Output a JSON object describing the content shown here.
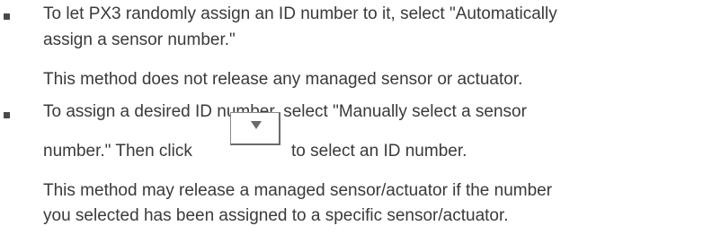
{
  "bullets": [
    {
      "lines": [
        "To let PX3 randomly assign an ID number to it, select \"Automatically",
        " assign a sensor number.\""
      ],
      "note": "This method does not release any managed sensor or actuator."
    },
    {
      "line1": "To assign a desired ID number, select \"Manually select a sensor",
      "line2_before": "number.\" Then click",
      "line2_after": "to select an ID number.",
      "button_icon": "dropdown-arrow-icon",
      "note_lines": [
        "This method may release a managed sensor/actuator if the number",
        "you selected has been assigned to a specific sensor/actuator."
      ]
    }
  ]
}
